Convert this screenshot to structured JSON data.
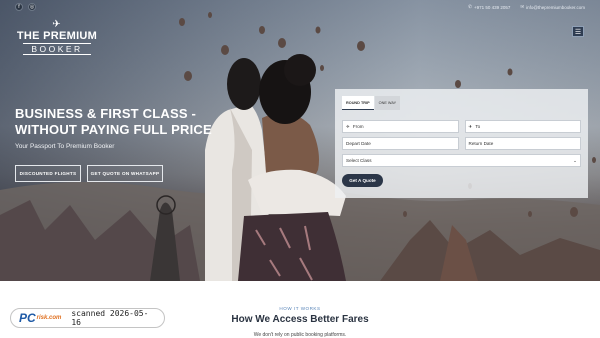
{
  "topbar": {
    "social": [
      {
        "icon": "facebook-icon",
        "glyph": "f"
      },
      {
        "icon": "instagram-icon",
        "glyph": "◎"
      }
    ],
    "phone_icon": "phone-icon",
    "phone": "+971 50 439 2057",
    "email_icon": "mail-icon",
    "email": "info@thepremiumbooker.com"
  },
  "logo": {
    "plane": "✈",
    "line1": "THE PREMIUM",
    "line2": "BOOKER"
  },
  "menu_icon": "☰",
  "hero": {
    "headline_line1": "BUSINESS & FIRST CLASS -",
    "headline_line2": "WITHOUT PAYING FULL PRICE",
    "subline": "Your Passport To Premium Booker",
    "btn_flights": "DISCOUNTED FLIGHTS",
    "btn_whatsapp": "GET QUOTE ON WHATSAPP"
  },
  "form": {
    "tab_round": "ROUND TRIP",
    "tab_oneway": "ONE WAY",
    "from_placeholder": "From",
    "to_placeholder": "To",
    "depart_placeholder": "Depart Date",
    "return_placeholder": "Return Date",
    "class_selected": "Select Class",
    "submit": "Get A Quote"
  },
  "section": {
    "eyebrow": "HOW IT WORKS",
    "title": "How We Access Better Fares",
    "text": "We don't rely on public booking platforms."
  },
  "watermark": {
    "brand_pc": "PC",
    "brand_risk": "risk.com",
    "text": "scanned 2026-05-16"
  },
  "colors": {
    "navy": "#2b3648",
    "accent": "#5a86b9"
  }
}
